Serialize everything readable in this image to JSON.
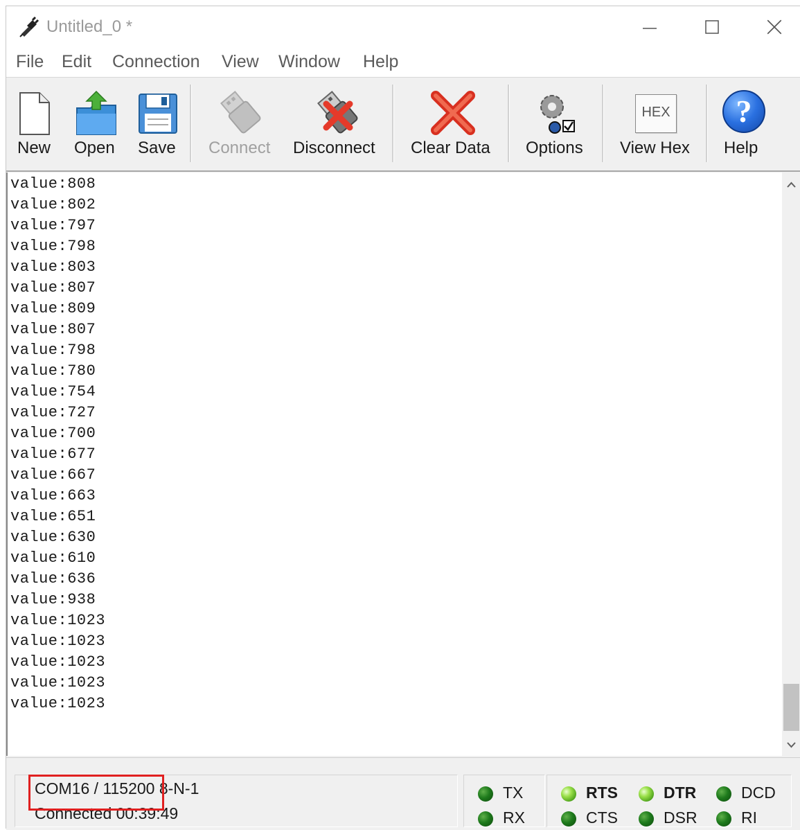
{
  "window": {
    "title": "Untitled_0 *",
    "controls": {
      "minimize_icon": "minimize-icon",
      "maximize_icon": "maximize-icon",
      "close_icon": "close-icon"
    }
  },
  "menu": {
    "items": [
      "File",
      "Edit",
      "Connection",
      "View",
      "Window",
      "Help"
    ]
  },
  "toolbar": {
    "new_label": "New",
    "open_label": "Open",
    "save_label": "Save",
    "connect_label": "Connect",
    "disconnect_label": "Disconnect",
    "clear_label": "Clear Data",
    "options_label": "Options",
    "viewhex_label": "View Hex",
    "viewhex_icon_text": "HEX",
    "help_label": "Help",
    "help_icon_text": "?"
  },
  "terminal": {
    "lines": [
      "value:808",
      "value:802",
      "value:797",
      "value:798",
      "value:803",
      "value:807",
      "value:809",
      "value:807",
      "value:798",
      "value:780",
      "value:754",
      "value:727",
      "value:700",
      "value:677",
      "value:667",
      "value:663",
      "value:651",
      "value:630",
      "value:610",
      "value:636",
      "value:938",
      "value:1023",
      "value:1023",
      "value:1023",
      "value:1023",
      "value:1023"
    ]
  },
  "status": {
    "port_prefix": "COM16 / 115200",
    "port_suffix": "8-N-1",
    "connection": "Connected 00:39:49"
  },
  "indicators": {
    "tx": "TX",
    "rx": "RX",
    "rts": "RTS",
    "cts": "CTS",
    "dtr": "DTR",
    "dsr": "DSR",
    "dcd": "DCD",
    "ri": "RI"
  },
  "colors": {
    "highlight": "#e02020",
    "led_on": "#9be04a",
    "led_off": "#1e7a1c"
  }
}
